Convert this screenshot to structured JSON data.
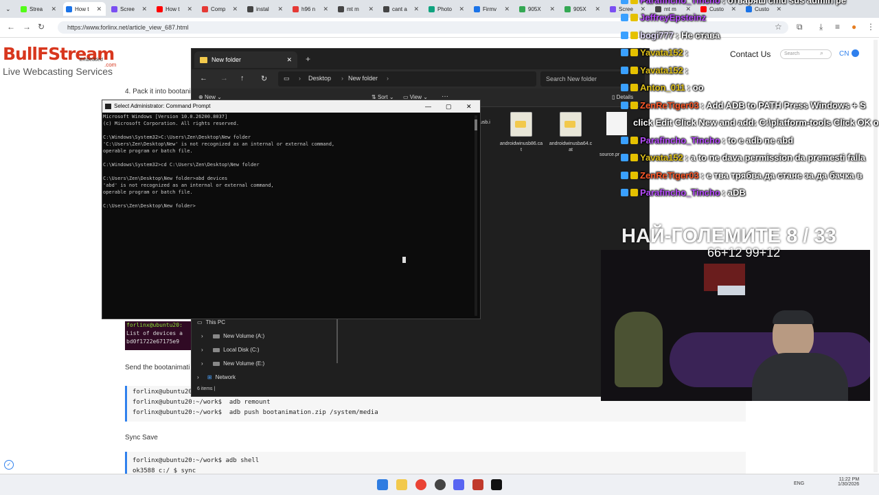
{
  "browser": {
    "tabs": [
      {
        "title": "Strea",
        "color": "#53fc18"
      },
      {
        "title": "How t",
        "color": "#1a73e8",
        "active": true
      },
      {
        "title": "Scree",
        "color": "#7b4ff2"
      },
      {
        "title": "How t",
        "color": "#ff0000"
      },
      {
        "title": "Comp",
        "color": "#e53935"
      },
      {
        "title": "instal",
        "color": "#444444"
      },
      {
        "title": "h96 n",
        "color": "#e53935"
      },
      {
        "title": "mt m",
        "color": "#444444"
      },
      {
        "title": "cant a",
        "color": "#444444"
      },
      {
        "title": "Photo",
        "color": "#10a37f"
      },
      {
        "title": "Firmv",
        "color": "#1a73e8"
      },
      {
        "title": "905X",
        "color": "#34a853"
      },
      {
        "title": "905X",
        "color": "#34a853"
      },
      {
        "title": "Scree",
        "color": "#7b4ff2"
      },
      {
        "title": "mt m",
        "color": "#444444"
      },
      {
        "title": "Custo",
        "color": "#ff0000"
      },
      {
        "title": "Custo",
        "color": "#1a73e8"
      }
    ],
    "url": "https://www.forlinx.net/article_view_687.html"
  },
  "site": {
    "logo_main": "BullFStream",
    "logo_sub": "Live Webcasting Services",
    "logo_tag": "Embedded",
    "logo_com": ".com",
    "nav_contact": "Contact Us",
    "search_placeholder": "Search",
    "lang": "CN",
    "nav_partial": "Comp",
    "step4": "4. Pack it into bootani",
    "terminal_lines": [
      "forlinx@ubuntu20:",
      "List of devices a",
      "bd0f1722e67175e9"
    ],
    "send_text": "Send the bootanimati",
    "code1": [
      "forlinx@ubuntu20",
      "forlinx@ubuntu20:~/work$  adb remount",
      "forlinx@ubuntu20:~/work$  adb push bootanimation.zip /system/media"
    ],
    "sync_text": "Sync Save",
    "code2": [
      "forlinx@ubuntu20:~/work$ adb shell",
      "ok3588 c:/ $ sync"
    ]
  },
  "explorer": {
    "tab_title": "New folder",
    "breadcrumb": [
      "Desktop",
      "New folder"
    ],
    "search_placeholder": "Search New folder",
    "cmd_new": "New",
    "cmd_sort": "Sort",
    "cmd_view": "View",
    "cmd_details": "Details",
    "files": [
      {
        "name": "androidwinusb86.cat"
      },
      {
        "name": "androidwinusba64.cat"
      }
    ],
    "partial_file_left": "usb.i",
    "partial_file_right": "source.pr",
    "tree": {
      "this_pc": "This PC",
      "volumes": [
        "New Volume (A:)",
        "Local Disk (C:)",
        "New Volume (E:)"
      ],
      "network": "Network"
    },
    "status": "6 items  |"
  },
  "cmd": {
    "title": "Select Administrator: Command Prompt",
    "output": "Microsoft Windows [Version 10.0.26200.8037]\n(c) Microsoft Corporation. All rights reserved.\n\nC:\\Windows\\System32>C:\\Users\\Zen\\Desktop\\New folder\n'C:\\Users\\Zen\\Desktop\\New' is not recognized as an internal or external command,\noperable program or batch file.\n\nC:\\Windows\\System32>cd C:\\Users\\Zen\\Desktop\\New folder\n\nC:\\Users\\Zen\\Desktop\\New folder>abd devices\n'abd' is not recognized as an internal or external command,\noperable program or batch file.\n\nC:\\Users\\Zen\\Desktop\\New folder>"
  },
  "chat": [
    {
      "user": "Parafincho_Tincho",
      "message": ": отваряш cmd sus admin pe",
      "color": "#b84dff"
    },
    {
      "user": "JeffreyEpsteinz",
      "message": "",
      "color": "#b84dff"
    },
    {
      "user": "bogi777",
      "message": ": Не става",
      "color": "#e8e0ff"
    },
    {
      "user": "Yavata152",
      "message": ":",
      "color": "#e0c21a"
    },
    {
      "user": "Yavata152",
      "message": ":",
      "color": "#e0c21a"
    },
    {
      "user": "Anton_011",
      "message": ": oo",
      "color": "#e0c21a"
    },
    {
      "user": "ZenReTiger03",
      "message": ": Add ADB to PATH Press Windows + S",
      "color": "#ff5a2a"
    },
    {
      "user": "",
      "message": "click Edit Click New and add: C:\\platform-tools Click OK o",
      "color": "#ffffff"
    },
    {
      "user": "Parafincho_Tincho",
      "message": ": to e adb ne abd",
      "color": "#b84dff"
    },
    {
      "user": "Yavata152",
      "message": ": a to ne dava permission da premesti falla",
      "color": "#e0c21a"
    },
    {
      "user": "ZenReTiger03",
      "message": ": e тва трябва да стане за да бачка в",
      "color": "#ff5a2a"
    },
    {
      "user": "Parafincho_Tincho",
      "message": ": aDB",
      "color": "#b84dff"
    }
  ],
  "overlay": {
    "title": "НАЙ-ГОЛЕМИТЕ 8 / 33",
    "score": "66+12 99+12"
  },
  "taskbar": {
    "lang": "ENG",
    "time": "11:22 PM",
    "date": "1/30/2026"
  }
}
